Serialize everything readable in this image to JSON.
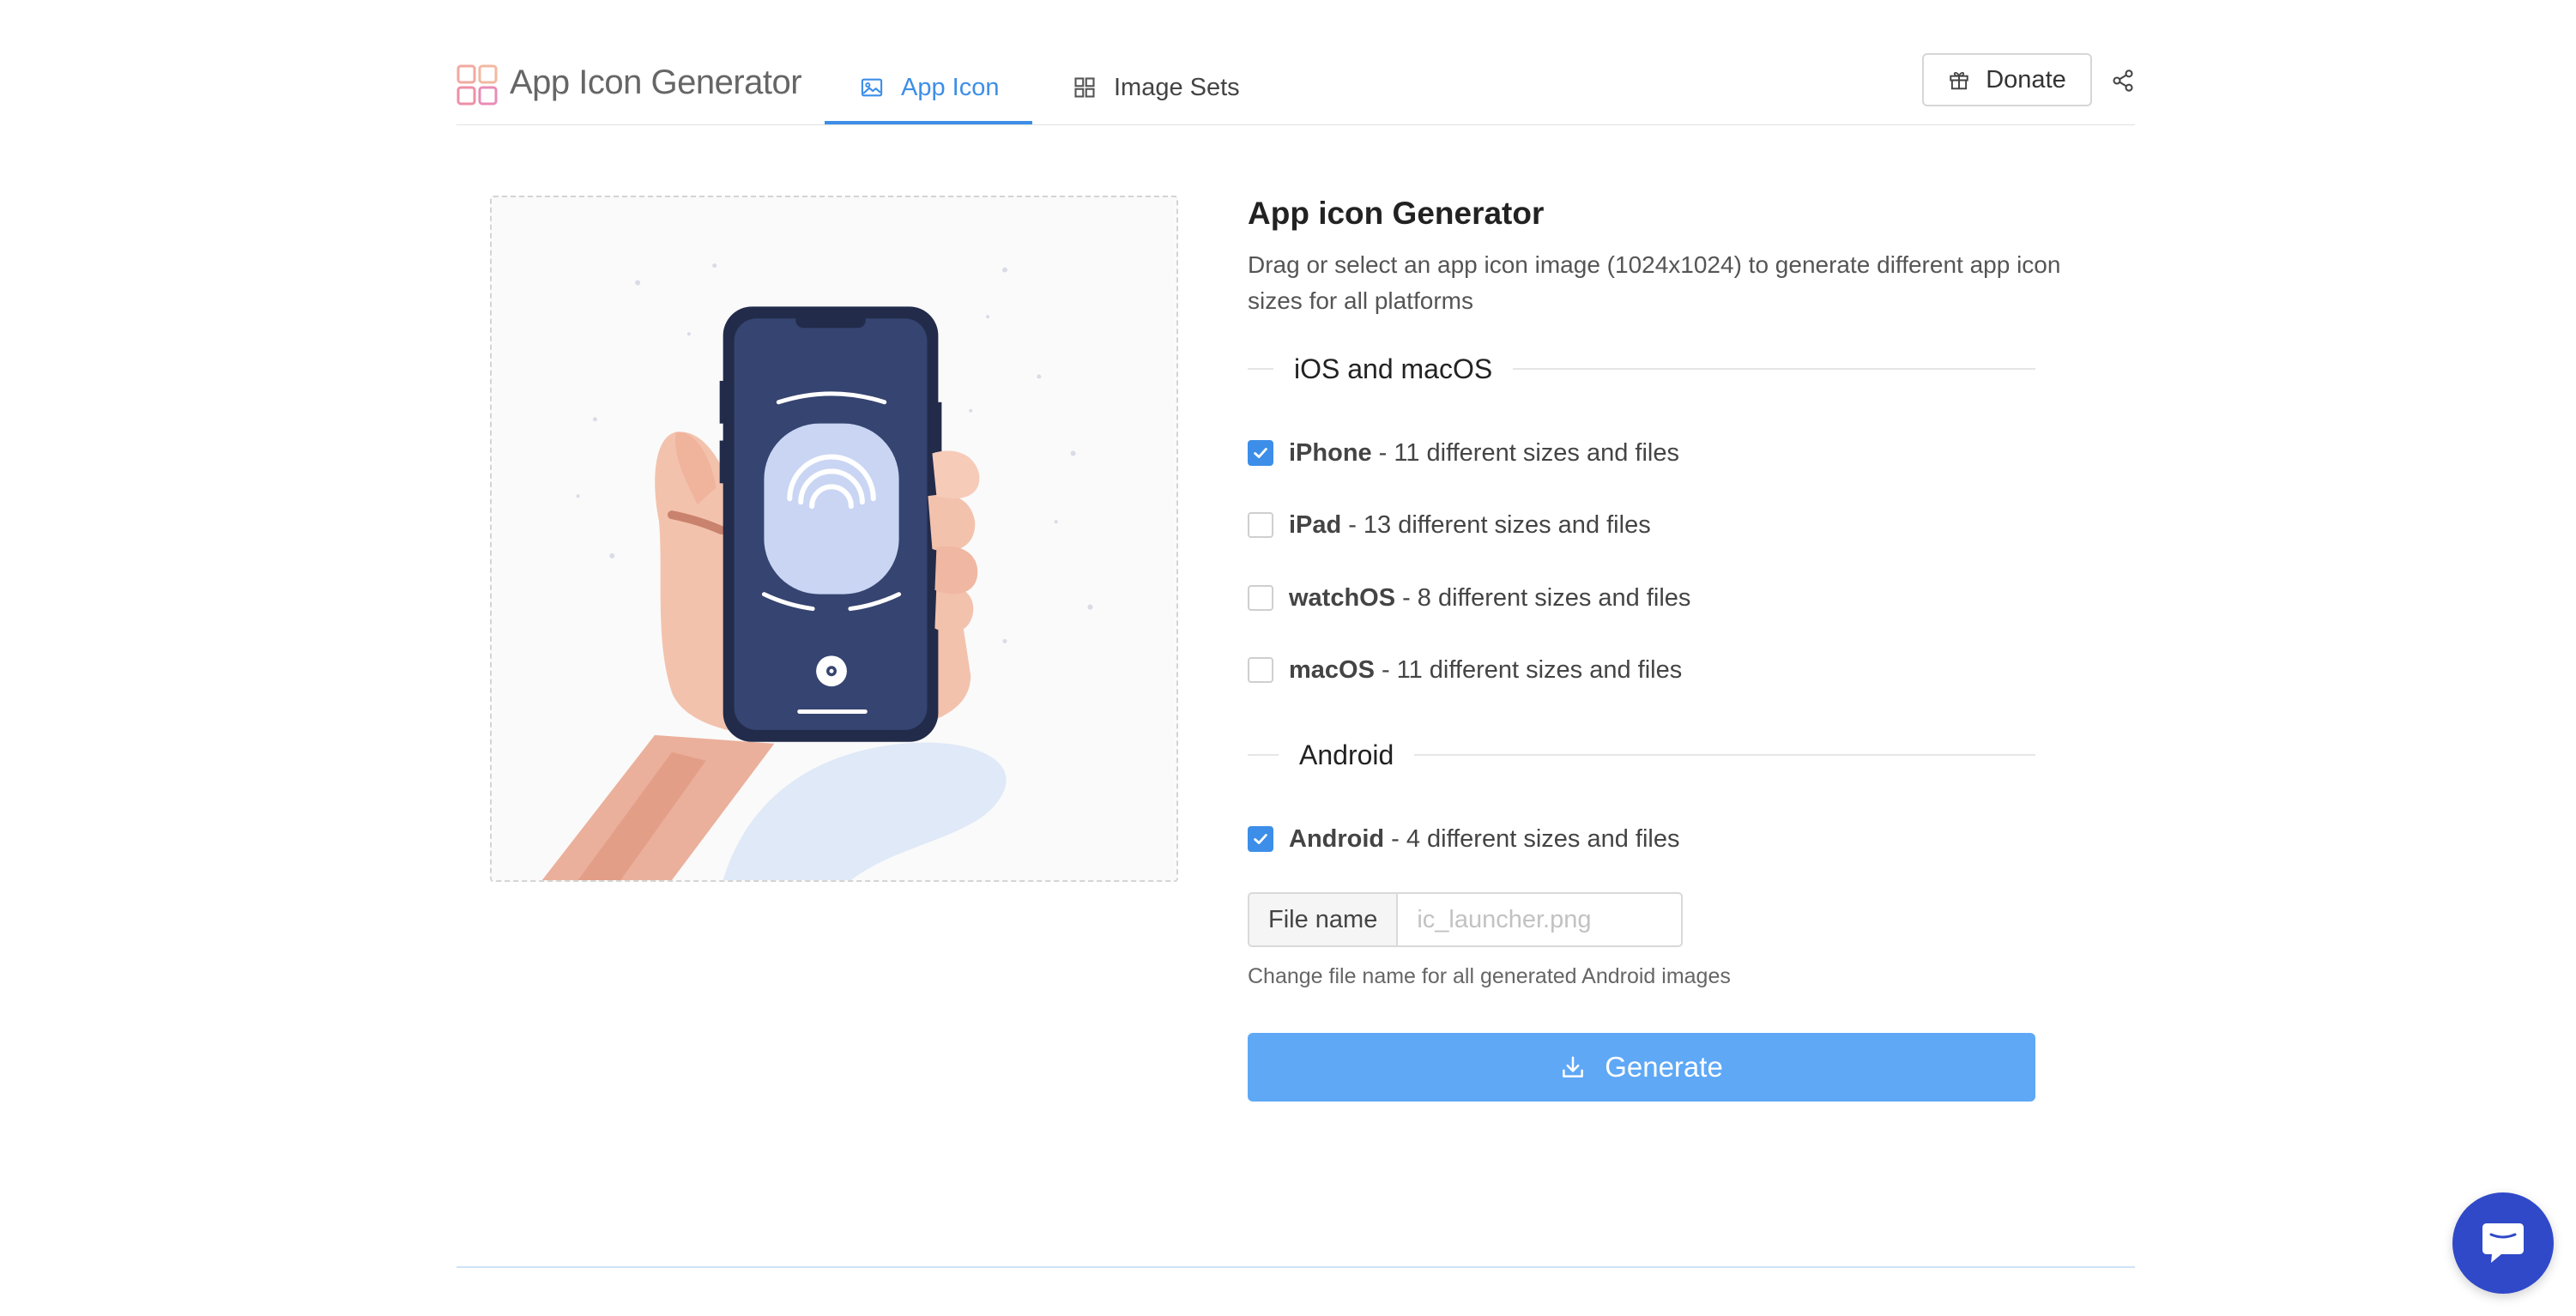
{
  "header": {
    "app_title": "App Icon Generator",
    "tabs": [
      {
        "label": "App Icon",
        "icon": "image-icon",
        "active": true
      },
      {
        "label": "Image Sets",
        "icon": "grid-icon",
        "active": false
      }
    ],
    "donate_label": "Donate",
    "donate_icon": "gift-icon",
    "share_icon": "share-icon"
  },
  "dropzone": {
    "illustration": "hand-holding-phone-fingerprint"
  },
  "panel": {
    "title": "App icon Generator",
    "description": "Drag or select an app icon image (1024x1024) to generate different app icon sizes for all platforms",
    "ios_section": "iOS and macOS",
    "ios_options": [
      {
        "name": "iPhone",
        "detail": "11 different sizes and files",
        "checked": true
      },
      {
        "name": "iPad",
        "detail": "13 different sizes and files",
        "checked": false
      },
      {
        "name": "watchOS",
        "detail": "8 different sizes and files",
        "checked": false
      },
      {
        "name": "macOS",
        "detail": "11 different sizes and files",
        "checked": false
      }
    ],
    "android_section": "Android",
    "android_option": {
      "name": "Android",
      "detail": "4 different sizes and files",
      "checked": true
    },
    "separator": "-",
    "file_name_label": "File name",
    "file_name_value": "",
    "file_name_placeholder": "ic_launcher.png",
    "file_name_help": "Change file name for all generated Android images",
    "generate_label": "Generate",
    "generate_icon": "download-icon"
  },
  "colors": {
    "accent": "#3d8ee8",
    "generate_button": "#5ea8f6",
    "chat_button": "#2f49c8"
  },
  "chat": {
    "icon": "chat-icon"
  }
}
